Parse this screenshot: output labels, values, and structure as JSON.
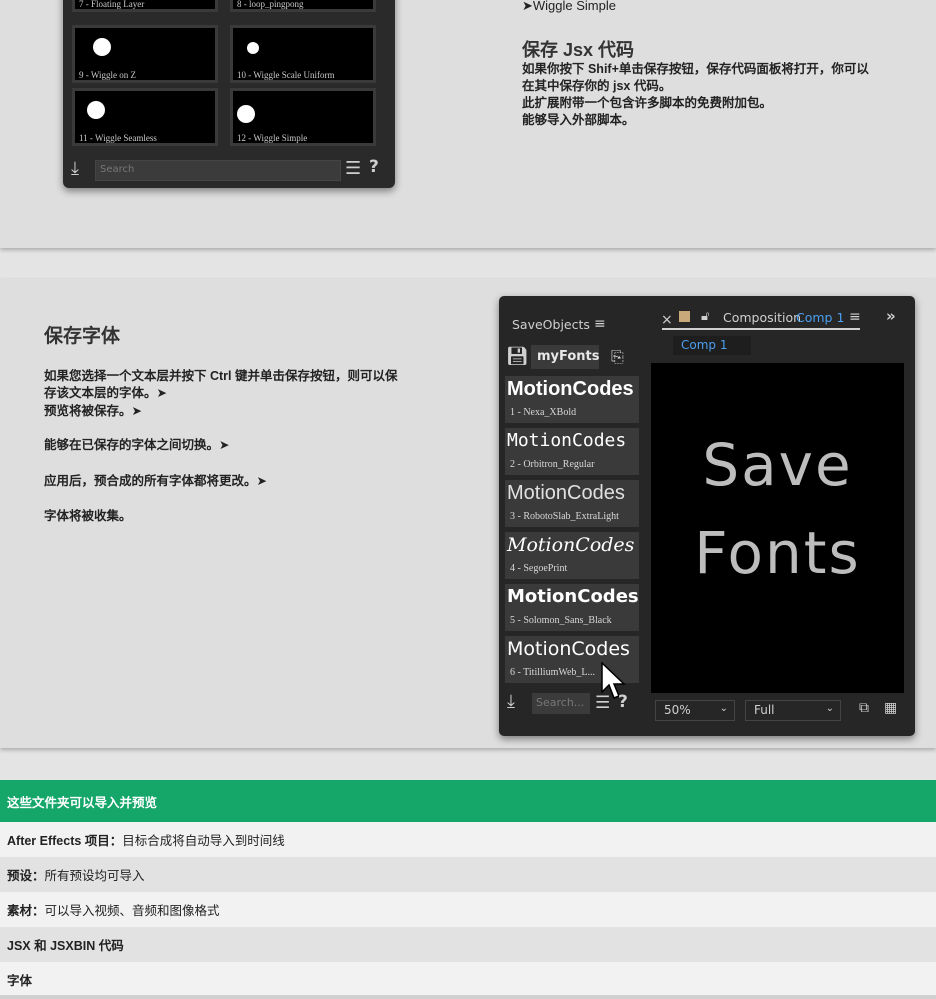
{
  "section1": {
    "tiles": [
      {
        "label": "7 - Floating Layer"
      },
      {
        "label": "8 - loop_pingpong"
      },
      {
        "label": "9 - Wiggle on Z"
      },
      {
        "label": "10 - Wiggle Scale Uniform"
      },
      {
        "label": "11 - Wiggle Seamless"
      },
      {
        "label": "12 - Wiggle Simple"
      }
    ],
    "search_placeholder": "Search",
    "help_glyph": "?",
    "wiggle_link": "➤Wiggle Simple",
    "heading": "保存 Jsx 代码",
    "paragraph_lines": [
      "如果你按下 Shif+单击保存按钮，保存代码面板将打开，你可以",
      "在其中保存你的 jsx 代码。",
      "此扩展附带一个包含许多脚本的免费附加包。",
      "能够导入外部脚本。"
    ]
  },
  "section2": {
    "heading": "保存字体",
    "lines": [
      "如果您选择一个文本层并按下 Ctrl 键并单击保存按钮，则可以保",
      "存该文本层的字体。➤",
      "预览将被保存。➤",
      "能够在已保存的字体之间切换。➤",
      "应用后，预合成的所有字体都将更改。➤",
      "字体将被收集。"
    ],
    "panel": {
      "title": "SaveObjects",
      "menu_glyph": "≡",
      "close_glyph": "×",
      "composition_label": "Composition",
      "comp_name": "Comp 1",
      "comp_tab": "Comp 1",
      "expand_glyph": "»",
      "folder_name": "myFonts",
      "fonts": [
        {
          "sample": "MotionCodes",
          "caption": "1 - Nexa_XBold"
        },
        {
          "sample": "MotionCodes",
          "caption": "2 - Orbitron_Regular"
        },
        {
          "sample": "MotionCodes",
          "caption": "3 - RobotoSlab_ExtraLight"
        },
        {
          "sample": "MotionCodes",
          "caption": "4 - SegoePrint"
        },
        {
          "sample": "MotionCodes",
          "caption": "5 - Solomon_Sans_Black"
        },
        {
          "sample": "MotionCodes",
          "caption": "6 - TitilliumWeb_L..."
        }
      ],
      "viewer_line1": "Save",
      "viewer_line2": "Fonts",
      "zoom": "50%",
      "resolution": "Full",
      "search_placeholder": "Search...",
      "help_glyph": "?"
    }
  },
  "table": {
    "header": "这些文件夹可以导入并预览",
    "rows": [
      {
        "bold": "After Effects 项目：",
        "text": "目标合成将自动导入到时间线"
      },
      {
        "bold": "预设：",
        "text": "所有预设均可导入"
      },
      {
        "bold": "素材：",
        "text": "可以导入视频、音频和图像格式"
      },
      {
        "bold": "JSX 和 JSXBIN 代码",
        "text": ""
      },
      {
        "bold": "字体",
        "text": ""
      }
    ]
  },
  "colors": {
    "accent_green": "#15a66a",
    "panel_dark": "#262626",
    "comp_blue": "#4a9ff0"
  }
}
